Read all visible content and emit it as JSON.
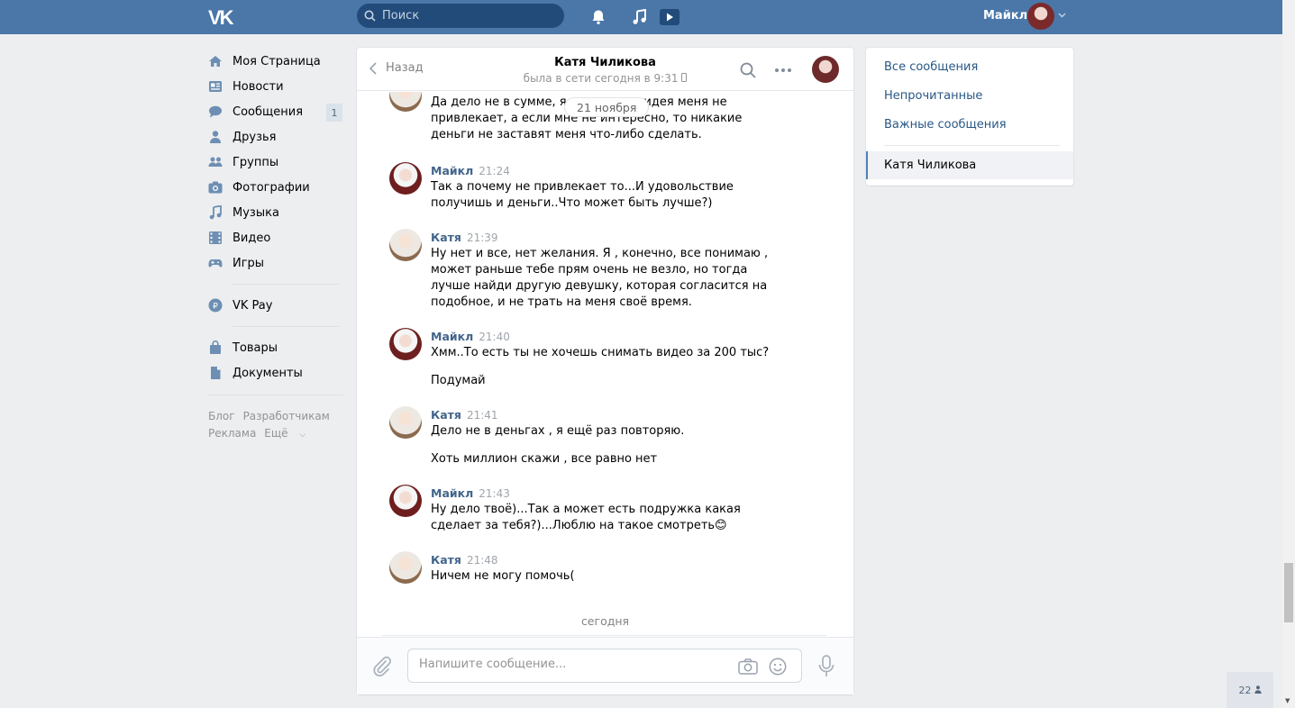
{
  "topbar": {
    "logo": "VK",
    "search_placeholder": "Поиск",
    "user_name": "Майкл",
    "colors": {
      "bar": "#4a76a8",
      "search_bg": "#224b7a"
    }
  },
  "leftnav": {
    "items": [
      {
        "label": "Моя Страница",
        "icon": "home-icon"
      },
      {
        "label": "Новости",
        "icon": "news-icon"
      },
      {
        "label": "Сообщения",
        "icon": "messages-icon",
        "badge": "1"
      },
      {
        "label": "Друзья",
        "icon": "friends-icon"
      },
      {
        "label": "Группы",
        "icon": "groups-icon"
      },
      {
        "label": "Фотографии",
        "icon": "camera-icon"
      },
      {
        "label": "Музыка",
        "icon": "music-icon"
      },
      {
        "label": "Видео",
        "icon": "video-icon"
      },
      {
        "label": "Игры",
        "icon": "gamepad-icon"
      }
    ],
    "vkpay": "VK Pay",
    "extra": [
      {
        "label": "Товары",
        "icon": "shopping-bag-icon"
      },
      {
        "label": "Документы",
        "icon": "document-icon"
      }
    ],
    "footer": [
      "Блог",
      "Разработчикам",
      "Реклама",
      "Ещё"
    ]
  },
  "chat": {
    "back_label": "Назад",
    "title": "Катя Чиликова",
    "status": "была в сети сегодня в 9:31",
    "date_pill": "21 ноября",
    "messages": [
      {
        "author": "",
        "time": "",
        "lines": [
          "Да дело не в сумме, я же говорю, идея меня не привлекает, а если мне не интересно, то никакие деньги не заставят меня что-либо сделать."
        ]
      },
      {
        "author": "Майкл",
        "time": "21:24",
        "lines": [
          "Так а почему не привлекает то...И удовольствие получишь и деньги..Что может быть лучше?)"
        ]
      },
      {
        "author": "Катя",
        "time": "21:39",
        "lines": [
          "Ну нет и все, нет желания. Я , конечно, все понимаю , может раньше тебе прям очень не везло, но тогда лучше найди другую девушку, которая согласится на подобное, и не трать на меня своё время."
        ]
      },
      {
        "author": "Майкл",
        "time": "21:40",
        "lines": [
          "Хмм..То есть ты не хочешь снимать видео за 200 тыс?",
          "Подумай"
        ]
      },
      {
        "author": "Катя",
        "time": "21:41",
        "lines": [
          "Дело не в деньгах , я ещё раз повторяю.",
          "Хоть миллион скажи , все равно нет"
        ]
      },
      {
        "author": "Майкл",
        "time": "21:43",
        "lines": [
          "Ну дело твоё)...Так а может есть подружка какая сделает за тебя?)...Люблю на такое смотреть😊"
        ]
      },
      {
        "author": "Катя",
        "time": "21:48",
        "lines": [
          "Ничем не могу помочь("
        ]
      }
    ],
    "today_label": "сегодня",
    "composer_placeholder": "Напишите сообщение..."
  },
  "rightpanel": {
    "items": [
      "Все сообщения",
      "Непрочитанные",
      "Важные сообщения"
    ],
    "active": "Катя Чиликова"
  },
  "online_counter": "22"
}
